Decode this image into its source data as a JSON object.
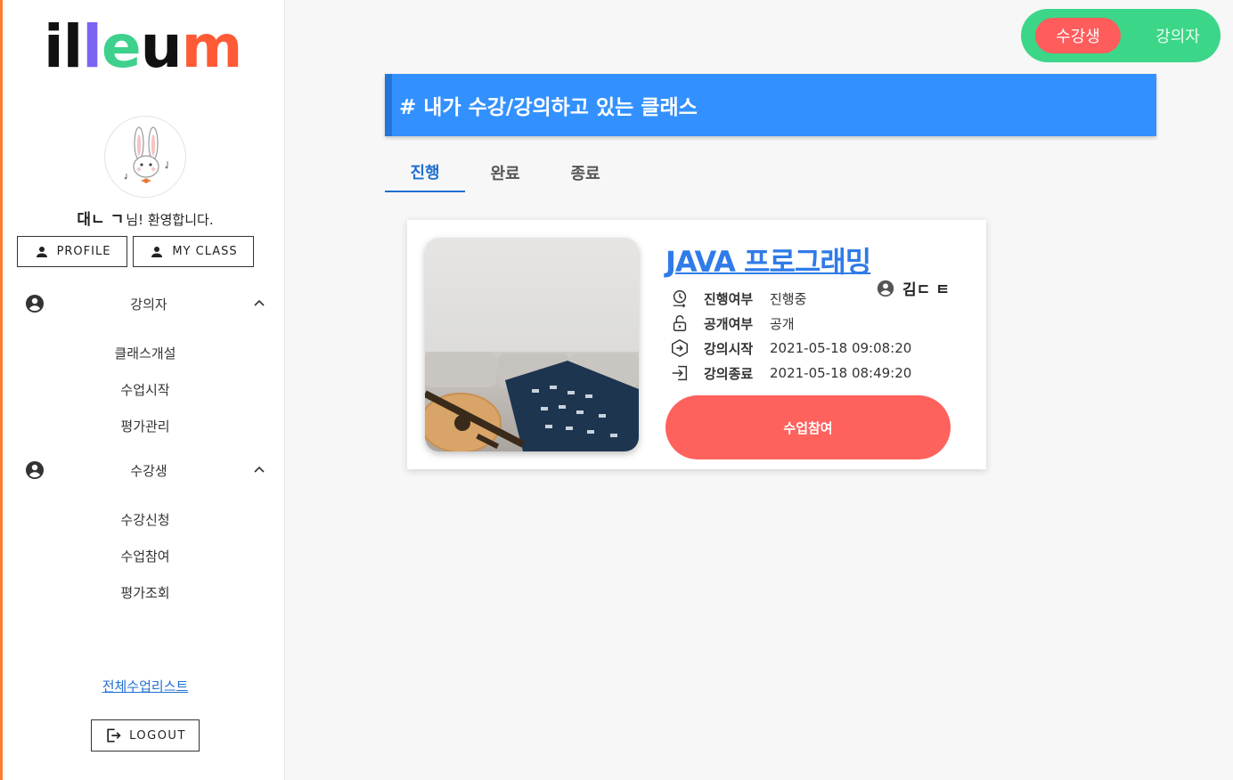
{
  "logo": {
    "text": "illeum"
  },
  "profile": {
    "name": "대ㄴ ㄱ",
    "welcome_suffix": "님! 환영합니다."
  },
  "buttons": {
    "profile": "PROFILE",
    "my_class": "MY CLASS",
    "logout": "LOGOUT"
  },
  "sidebar": {
    "lecturer": {
      "label": "강의자",
      "items": [
        "클래스개설",
        "수업시작",
        "평가관리"
      ]
    },
    "student": {
      "label": "수강생",
      "items": [
        "수강신청",
        "수업참여",
        "평가조회"
      ]
    },
    "all_classes_link": "전체수업리스트"
  },
  "role_toggle": {
    "student": "수강생",
    "lecturer": "강의자",
    "active": "student"
  },
  "banner": {
    "title": "# 내가 수강/강의하고 있는 클래스"
  },
  "tabs": [
    "진행",
    "완료",
    "종료"
  ],
  "class_card": {
    "title": "JAVA 프로그래밍",
    "owner": "김ㄷ ㅌ",
    "rows": [
      {
        "key": "진행여부",
        "value": "진행중"
      },
      {
        "key": "공개여부",
        "value": "공개"
      },
      {
        "key": "강의시작",
        "value": "2021-05-18 09:08:20"
      },
      {
        "key": "강의종료",
        "value": "2021-05-18 08:49:20"
      }
    ],
    "join_label": "수업참여"
  },
  "colors": {
    "accent_blue": "#3391ff",
    "link_blue": "#1f6fd1",
    "toggle_green": "#3cd688",
    "action_red": "#ff615c",
    "sidebar_border": "#ff7a2f"
  }
}
